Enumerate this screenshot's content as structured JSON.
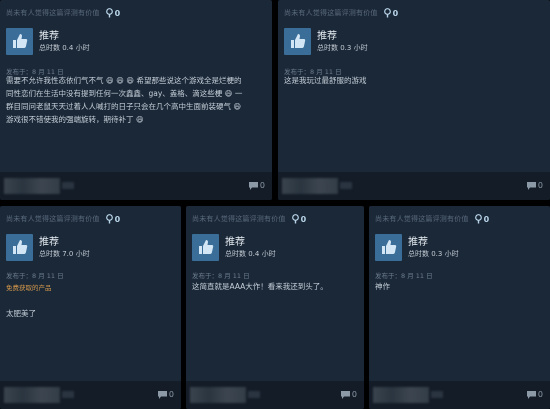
{
  "reviews": [
    {
      "helpful": "尚未有人觉得这篇评测有价值",
      "award_count": "0",
      "recommend": "推荐",
      "hours": "总时数 0.4 小时",
      "date": "发布于：8 月 11 日",
      "lines": [
        "需要不允许我性态依们气不气 😄 😄 😄 希望那些说这个游戏全是烂梗的",
        "同性恋们在生活中没有提到任何一次鑫鑫、gay、盖格、滴这些梗 😄 一",
        "群目同问老鼠天天过着人人喊打的日子只会在几个高中生面前装硬气 😄",
        "游戏很不错使我的强端旋转，期待补丁 😄"
      ],
      "comment_count": "0"
    },
    {
      "helpful": "尚未有人觉得这篇评测有价值",
      "award_count": "0",
      "recommend": "推荐",
      "hours": "总时数 0.3 小时",
      "date": "发布于：8 月 11 日",
      "lines": [
        "这是我玩过最舒服的游戏"
      ],
      "comment_count": "0"
    },
    {
      "helpful": "尚未有人觉得这篇评测有价值",
      "award_count": "0",
      "recommend": "推荐",
      "hours": "总时数 7.0 小时",
      "date": "发布于：8 月 11 日",
      "source": "免费获取的产品",
      "lines": [
        "太肥美了"
      ],
      "comment_count": "0"
    },
    {
      "helpful": "尚未有人觉得这篇评测有价值",
      "award_count": "0",
      "recommend": "推荐",
      "hours": "总时数 0.4 小时",
      "date": "发布于：8 月 11 日",
      "lines": [
        "这简直就是AAA大作！看来我还到头了。"
      ],
      "comment_count": "0"
    },
    {
      "helpful": "尚未有人觉得这篇评测有价值",
      "award_count": "0",
      "recommend": "推荐",
      "hours": "总时数 0.3 小时",
      "date": "发布于：8 月 11 日",
      "lines": [
        "神作"
      ],
      "comment_count": "0"
    }
  ],
  "colors": {
    "card_bg": "#1b2838",
    "thumb_bg": "#3a6e98",
    "orange": "#d79a4a"
  }
}
